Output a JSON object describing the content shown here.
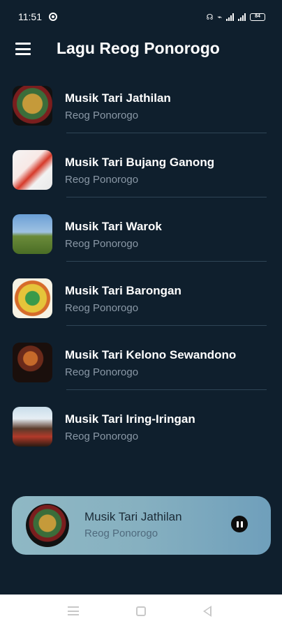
{
  "status_bar": {
    "time": "11:51",
    "battery": "84"
  },
  "app_bar": {
    "title": "Lagu Reog Ponorogo",
    "menu_icon": "hamburger-menu-icon"
  },
  "songs": [
    {
      "title": "Musik Tari Jathilan",
      "subtitle": "Reog Ponorogo"
    },
    {
      "title": "Musik Tari Bujang Ganong",
      "subtitle": "Reog Ponorogo"
    },
    {
      "title": "Musik Tari Warok",
      "subtitle": "Reog Ponorogo"
    },
    {
      "title": "Musik Tari Barongan",
      "subtitle": "Reog Ponorogo"
    },
    {
      "title": "Musik Tari Kelono Sewandono",
      "subtitle": "Reog Ponorogo"
    },
    {
      "title": "Musik Tari Iring-Iringan",
      "subtitle": "Reog Ponorogo"
    }
  ],
  "now_playing": {
    "title": "Musik Tari Jathilan",
    "subtitle": "Reog Ponorogo",
    "control_icon": "pause-icon"
  },
  "colors": {
    "background": "#0f1f2d",
    "subtitle_text": "#8a98a6",
    "divider": "#2f4556"
  }
}
